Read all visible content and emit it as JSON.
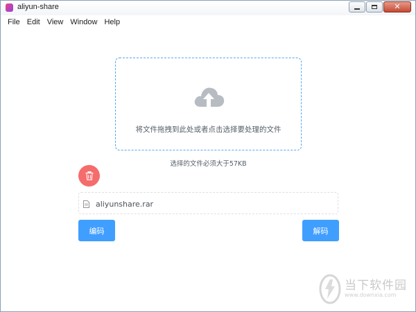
{
  "window": {
    "title": "aliyun-share"
  },
  "menu": {
    "items": [
      "File",
      "Edit",
      "View",
      "Window",
      "Help"
    ]
  },
  "dropzone": {
    "text": "将文件拖拽到此处或者点击选择要处理的文件",
    "icon": "upload-cloud-icon"
  },
  "hint": "选择的文件必须大于57KB",
  "file": {
    "name": "aliyunshare.rar",
    "icon": "document-icon"
  },
  "buttons": {
    "encode": "编码",
    "decode": "解码",
    "delete_icon": "trash-icon"
  },
  "watermark": {
    "title": "当下软件园",
    "url": "www.downxia.com"
  },
  "colors": {
    "accent": "#409eff",
    "danger": "#f56c6c",
    "dropzone_border": "#54a8f0"
  }
}
